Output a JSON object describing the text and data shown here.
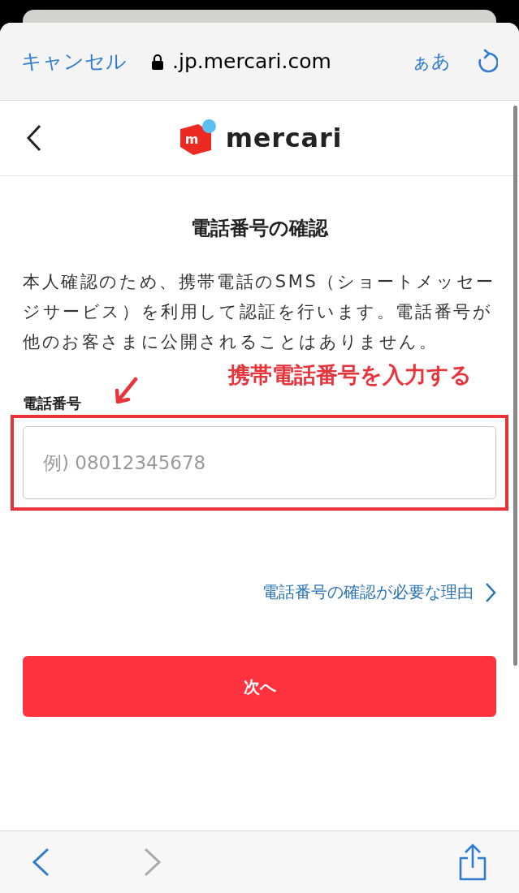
{
  "browser_bar": {
    "cancel": "キャンセル",
    "url": ".jp.mercari.com",
    "text_size": "ぁあ"
  },
  "header": {
    "logo_mark": "m",
    "logo_text": "mercari"
  },
  "title": "電話番号の確認",
  "description": "本人確認のため、携帯電話のSMS（ショートメッセージサービス）を利用して認証を行います。電話番号が他のお客さまに公開されることはありません。",
  "annotation": "携帯電話番号を入力する",
  "phone_field": {
    "label": "電話番号",
    "placeholder": "例) 08012345678"
  },
  "reason_link": "電話番号の確認が必要な理由",
  "next_button": "次へ",
  "toolbar": {
    "back": {
      "disabled": false
    },
    "forward": {
      "disabled": true
    }
  }
}
